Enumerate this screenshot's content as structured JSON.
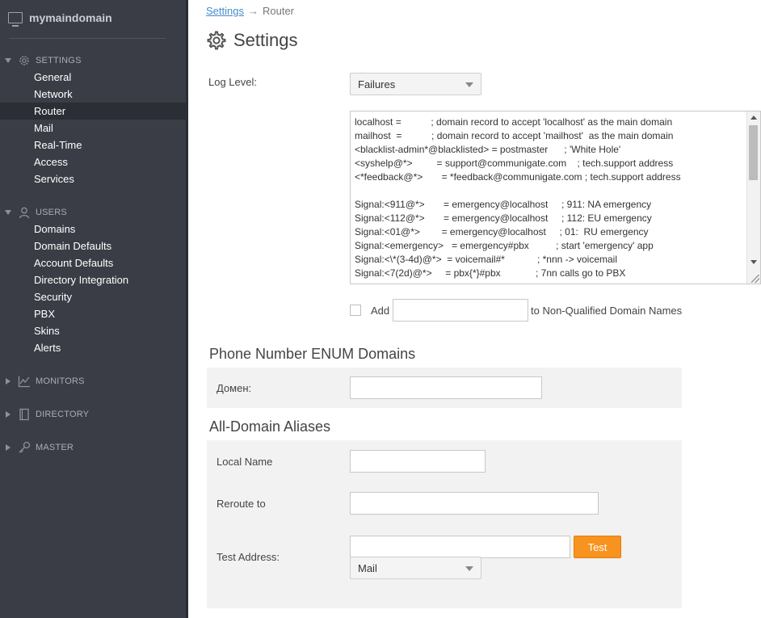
{
  "sidebar": {
    "brand": "mymaindomain",
    "sections": [
      {
        "label": "SETTINGS"
      },
      {
        "label": "USERS"
      },
      {
        "label": "MONITORS"
      },
      {
        "label": "DIRECTORY"
      },
      {
        "label": "MASTER"
      }
    ],
    "settings_items": [
      "General",
      "Network",
      "Router",
      "Mail",
      "Real-Time",
      "Access",
      "Services"
    ],
    "users_items": [
      "Domains",
      "Domain Defaults",
      "Account Defaults",
      "Directory Integration",
      "Security",
      "PBX",
      "Skins",
      "Alerts"
    ],
    "active_item": "Router"
  },
  "breadcrumb": {
    "parent": "Settings",
    "arrow": "→",
    "current": "Router"
  },
  "page_title": "Settings",
  "log_level": {
    "label": "Log Level:",
    "value": "Failures"
  },
  "router_table": {
    "lines": [
      "localhost =           ; domain record to accept 'localhost' as the main domain",
      "mailhost  =           ; domain record to accept 'mailhost'  as the main domain",
      "<blacklist-admin*@blacklisted> = postmaster      ; 'White Hole'",
      "<syshelp@*>         = support@communigate.com    ; tech.support address",
      "<*feedback@*>       = *feedback@communigate.com ; tech.support address",
      "",
      "Signal:<911@*>       = emergency@localhost     ; 911: NA emergency",
      "Signal:<112@*>       = emergency@localhost     ; 112: EU emergency",
      "Signal:<01@*>        = emergency@localhost     ; 01:  RU emergency",
      "Signal:<emergency>   = emergency#pbx          ; start 'emergency' app",
      "Signal:<\\*(3-4d)@*>  = voicemail#*            ; *nnn -> voicemail",
      "Signal:<7(2d)@*>     = pbx{*}#pbx             ; 7nn calls go to PBX"
    ]
  },
  "non_qualified": {
    "add_label": "Add",
    "input_value": "",
    "suffix": "to Non-Qualified Domain Names"
  },
  "enum_section": {
    "title": "Phone Number ENUM Domains",
    "field_label": "Домен:",
    "value": ""
  },
  "aliases_section": {
    "title": "All-Domain Aliases",
    "local_name_label": "Local Name",
    "reroute_label": "Reroute to",
    "test_address_label": "Test Address:",
    "test_button": "Test",
    "protocol_value": "Mail"
  }
}
